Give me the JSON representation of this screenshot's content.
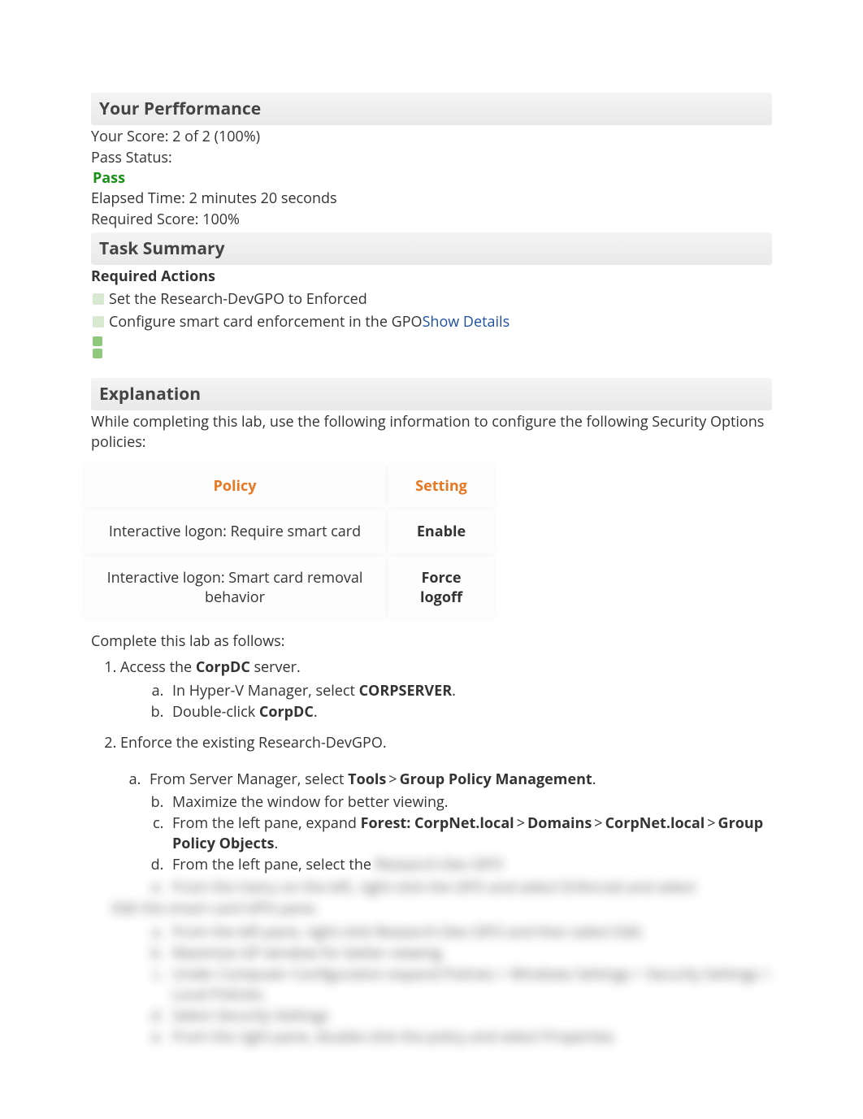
{
  "headers": {
    "performance": "Your Perfformance",
    "task_summary": "Task Summary",
    "explanation": "Explanation"
  },
  "performance": {
    "score_line": "Your Score: 2 of 2 (100%)",
    "pass_label": "Pass Status:",
    "pass_value": "Pass",
    "elapsed": "Elapsed Time: 2 minutes 20 seconds",
    "required": "Required Score: 100%"
  },
  "task_summary": {
    "required_actions_label": "Required Actions",
    "action1": "Set the Research-DevGPO to Enforced",
    "action2": "Configure smart card enforcement in the GPO",
    "show_details": "Show Details"
  },
  "explanation": {
    "intro": "While completing this lab, use the following information to configure the following Security Options policies:",
    "table": {
      "col_policy": "Policy",
      "col_setting": "Setting",
      "row1_policy": "Interactive logon: Require smart card",
      "row1_setting": "Enable",
      "row2_policy": "Interactive logon: Smart card removal behavior",
      "row2_setting": "Force logoff"
    },
    "complete_line": "Complete this lab as follows:",
    "step1": {
      "text": "Access the ",
      "bold": "CorpDC",
      "suffix": " server.",
      "a_pre": "In Hyper-V Manager, select ",
      "a_bold": "CORPSERVER",
      "b_pre": "Double-click ",
      "b_bold": "CorpDC"
    },
    "step2": {
      "text": "Enforce the existing Research-DevGPO.",
      "a_pre": "From Server Manager, select ",
      "a_b1": "Tools",
      "a_b2": "Group Policy Management",
      "b": "Maximize the window for better viewing.",
      "c_pre": "From the left pane, expand ",
      "c_b1": "Forest: CorpNet.local",
      "c_b2": "Domains",
      "c_b3": "CorpNet.local",
      "c_b4": "Group Policy Objects",
      "d_pre": "From the left pane, select the "
    },
    "blurred_lines": [
      "From the menu on the left, right-click the GPO and select Enforced and select",
      "and Enforced",
      "Edit the smart card GPO pane.",
      "From the left pane, right-click Research-Dev GPO and then select Edit.",
      "Maximize GP window for better viewing.",
      "Under Computer Configuration expand Policies > Windows Settings > Security Settings > Local Policies.",
      "Select Security Settings",
      "From the right pane, double-click the policy and select Properties"
    ]
  }
}
